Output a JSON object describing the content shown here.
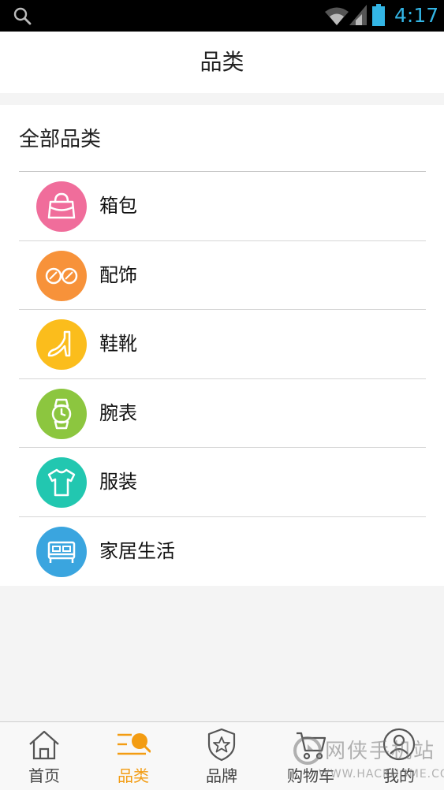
{
  "status_bar": {
    "time": "4:17",
    "icons": [
      "search-icon",
      "wifi-icon",
      "signal-icon",
      "battery-icon"
    ],
    "accent_color": "#33b5e5"
  },
  "header": {
    "title": "品类"
  },
  "categories": {
    "section_title": "全部品类",
    "items": [
      {
        "label": "箱包",
        "icon": "handbag-icon",
        "color": "#f06d9b"
      },
      {
        "label": "配饰",
        "icon": "sunglasses-icon",
        "color": "#f7923a"
      },
      {
        "label": "鞋靴",
        "icon": "high-heel-icon",
        "color": "#fbbd1c"
      },
      {
        "label": "腕表",
        "icon": "watch-icon",
        "color": "#8cc63f"
      },
      {
        "label": "服装",
        "icon": "tshirt-icon",
        "color": "#22c7b0"
      },
      {
        "label": "家居生活",
        "icon": "bed-icon",
        "color": "#3aa5df"
      }
    ]
  },
  "bottom_nav": {
    "active_color": "#f39c12",
    "items": [
      {
        "label": "首页",
        "icon": "home-icon"
      },
      {
        "label": "品类",
        "icon": "category-search-icon",
        "active": true
      },
      {
        "label": "品牌",
        "icon": "brand-shield-icon"
      },
      {
        "label": "购物车",
        "icon": "cart-icon"
      },
      {
        "label": "我的",
        "icon": "profile-icon"
      }
    ]
  },
  "watermark": {
    "text": "网侠手机站",
    "url": "WWW.HACKHOME.COM"
  }
}
